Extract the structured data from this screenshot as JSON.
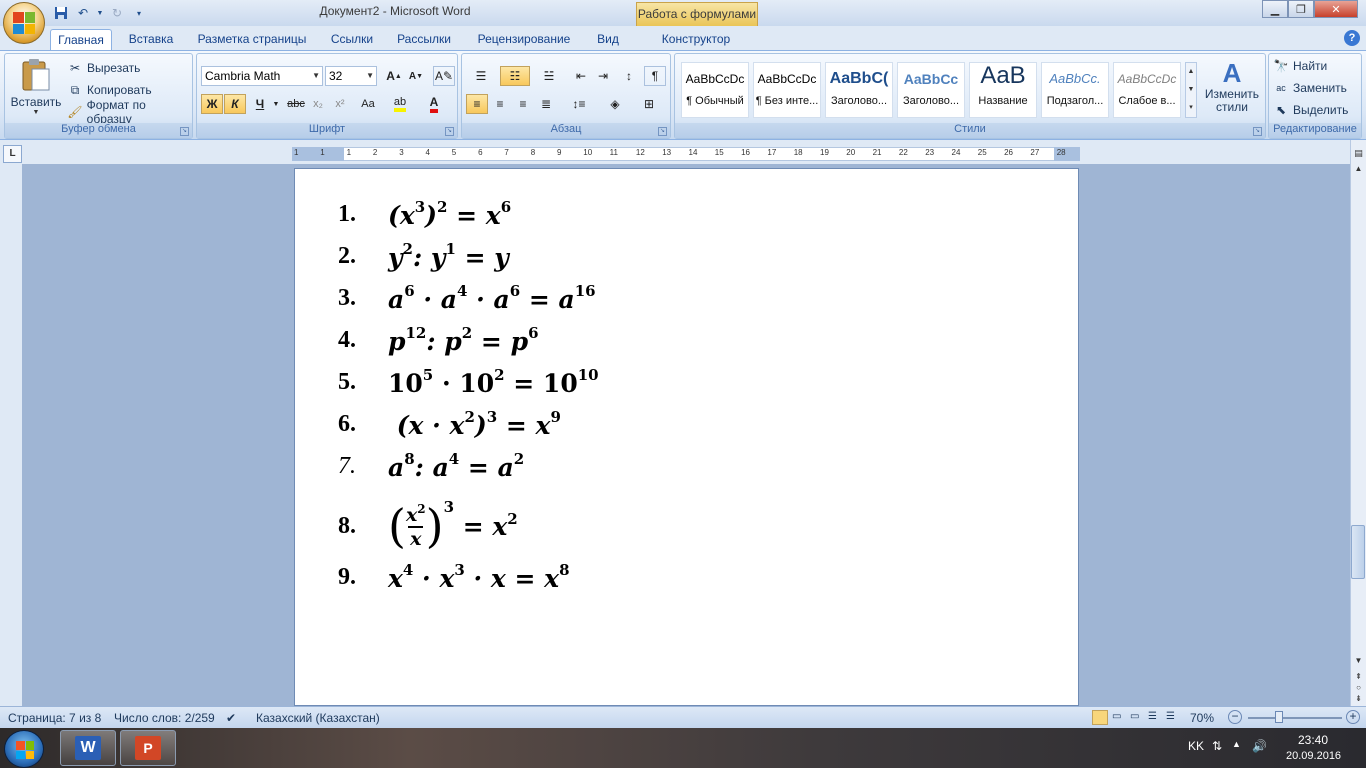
{
  "window": {
    "title": "Документ2 - Microsoft Word",
    "context_tab": "Работа с формулами"
  },
  "tabs": [
    "Главная",
    "Вставка",
    "Разметка страницы",
    "Ссылки",
    "Рассылки",
    "Рецензирование",
    "Вид",
    "Конструктор"
  ],
  "active_tab": "Главная",
  "ribbon": {
    "clipboard": {
      "label": "Буфер обмена",
      "paste": "Вставить",
      "cut": "Вырезать",
      "copy": "Копировать",
      "format_painter": "Формат по образцу"
    },
    "font": {
      "label": "Шрифт",
      "font_name": "Cambria Math",
      "font_size": "32",
      "bold": "Ж",
      "italic": "К",
      "underline": "Ч",
      "strike": "abc",
      "change_case": "Aa"
    },
    "paragraph": {
      "label": "Абзац"
    },
    "styles": {
      "label": "Стили",
      "items": [
        {
          "preview": "AaBbCcDc",
          "name": "¶ Обычный"
        },
        {
          "preview": "AaBbCcDc",
          "name": "¶ Без инте..."
        },
        {
          "preview": "AaBbC(",
          "name": "Заголово..."
        },
        {
          "preview": "AaBbCc",
          "name": "Заголово..."
        },
        {
          "preview": "AaB",
          "name": "Название"
        },
        {
          "preview": "AaBbCc.",
          "name": "Подзагол..."
        },
        {
          "preview": "AaBbCcDc",
          "name": "Слабое в..."
        }
      ],
      "change_styles": "Изменить стили"
    },
    "editing": {
      "label": "Редактирование",
      "find": "Найти",
      "replace": "Заменить",
      "select": "Выделить"
    }
  },
  "ruler_numbers": [
    "1",
    "1",
    "1",
    "2",
    "3",
    "4",
    "5",
    "6",
    "7",
    "8",
    "9",
    "10",
    "11",
    "12",
    "13",
    "14",
    "15",
    "16",
    "17",
    "18",
    "19",
    "20",
    "21",
    "22",
    "23",
    "24",
    "25",
    "26",
    "27",
    "28"
  ],
  "document": {
    "equations": [
      {
        "num": "1.",
        "html_id": "eq1"
      },
      {
        "num": "2.",
        "html_id": "eq2"
      },
      {
        "num": "3.",
        "html_id": "eq3"
      },
      {
        "num": "4.",
        "html_id": "eq4"
      },
      {
        "num": "5.",
        "html_id": "eq5"
      },
      {
        "num": "6.",
        "html_id": "eq6"
      },
      {
        "num": "7.",
        "html_id": "eq7"
      },
      {
        "num": "8.",
        "html_id": "eq8"
      },
      {
        "num": "9.",
        "html_id": "eq9"
      }
    ],
    "eq_text": {
      "eq1": [
        "(x",
        "3",
        ")",
        "2",
        " = x",
        "6"
      ],
      "eq2": [
        "y",
        "2",
        ": y",
        "1",
        " = y"
      ],
      "eq3": [
        "a",
        "6",
        " · a",
        "4",
        " · a",
        "6",
        " = a",
        "16"
      ],
      "eq4": [
        "p",
        "12",
        ": p",
        "2",
        " = p",
        "6"
      ],
      "eq5": [
        "10",
        "5",
        " · 10",
        "2",
        " = 10",
        "10"
      ],
      "eq6": [
        " (x · x",
        "2",
        ")",
        "3",
        " = x",
        "9"
      ],
      "eq7": [
        "a",
        "8",
        ": a",
        "4",
        " = a",
        "2"
      ],
      "eq8": {
        "frac_num": "x",
        "frac_num_exp": "2",
        "frac_den": "x",
        "outer_exp": "3",
        "rhs": " = x",
        "rhs_exp": "2"
      },
      "eq9": [
        "x",
        "4",
        " · x",
        "3",
        " · x = x",
        "8"
      ]
    }
  },
  "statusbar": {
    "page": "Страница: 7 из 8",
    "words": "Число слов: 2/259",
    "language": "Казахский (Казахстан)",
    "zoom": "70%",
    "zoom_level_percent": 70
  },
  "taskbar": {
    "lang": "KK",
    "time": "23:40",
    "date": "20.09.2016"
  }
}
